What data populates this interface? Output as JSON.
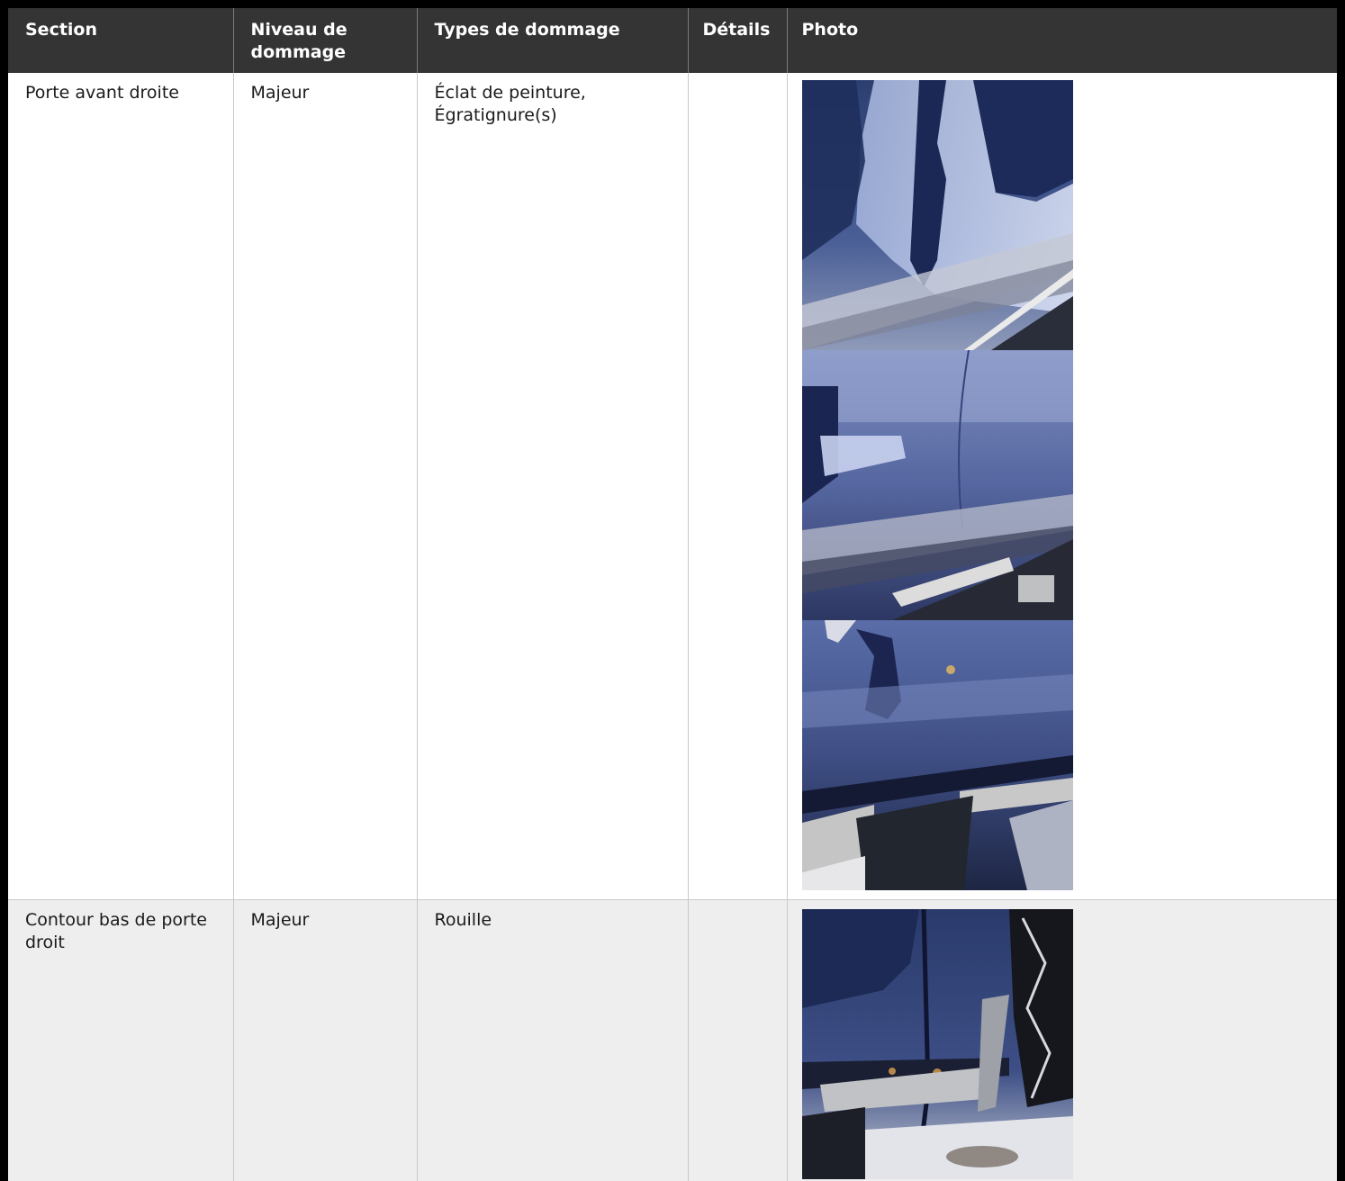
{
  "table": {
    "headers": {
      "section": "Section",
      "level": "Niveau de dommage",
      "types": "Types de dommage",
      "details": "Détails",
      "photo": "Photo"
    },
    "rows": [
      {
        "section": "Porte avant droite",
        "level": "Majeur",
        "types": "Éclat de peinture, Égratignure(s)",
        "details": "",
        "photos": [
          "photo-door-scratch-1",
          "photo-door-scratch-2",
          "photo-door-scratch-3"
        ]
      },
      {
        "section": "Contour bas de porte droit",
        "level": "Majeur",
        "types": "Rouille",
        "details": "",
        "photos": [
          "photo-rocker-rust-1"
        ]
      }
    ]
  },
  "colors": {
    "header_bg": "#343434",
    "header_text": "#ffffff",
    "row_alt_bg": "#eeeeee",
    "border": "#c9c9c9",
    "frame": "#000000"
  }
}
